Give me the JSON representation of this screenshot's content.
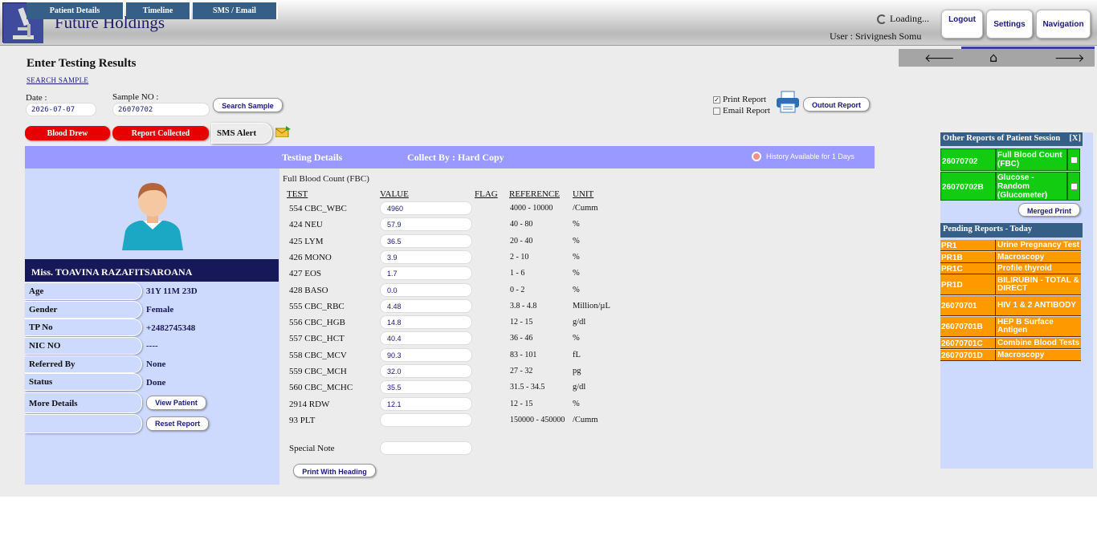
{
  "header": {
    "app_title": "Future Holdings",
    "loading_text": "Loading...",
    "user_line": "User : Srivignesh Somu",
    "buttons": {
      "logout": "Logout",
      "settings": "Settings",
      "navigation": "Navigation"
    }
  },
  "page": {
    "heading": "Enter Testing Results",
    "search_link": "SEARCH SAMPLE",
    "date_label": "Date :",
    "date_value": "2026-07-07",
    "sample_label": "Sample NO :",
    "sample_value": "26070702",
    "search_button": "Search Sample",
    "print_report_label": "Print Report",
    "email_report_label": "Email Report",
    "print_report_checked": true,
    "email_report_checked": false,
    "output_button": "Outout Report",
    "blood_drew": "Blood Drew",
    "report_collected": "Report Collected",
    "sms_alert": "SMS Alert"
  },
  "tabs": [
    "Patient Details",
    "Timeline",
    "SMS / Email"
  ],
  "testing": {
    "title": "Testing Details",
    "collect_by": "Collect By : Hard Copy",
    "history_note": "History Available for 1 Days",
    "panel_name": "Full Blood Count (FBC)",
    "columns": [
      "TEST",
      "VALUE",
      "FLAG",
      "REFERENCE",
      "UNIT"
    ],
    "rows": [
      {
        "test": "554 CBC_WBC",
        "value": "4960",
        "ref": "4000 - 10000",
        "unit": "/Cumm"
      },
      {
        "test": "424 NEU",
        "value": "57.9",
        "ref": "40 - 80",
        "unit": "%"
      },
      {
        "test": "425 LYM",
        "value": "36.5",
        "ref": "20 - 40",
        "unit": "%"
      },
      {
        "test": "426 MONO",
        "value": "3.9",
        "ref": "2 - 10",
        "unit": "%"
      },
      {
        "test": "427 EOS",
        "value": "1.7",
        "ref": "1 - 6",
        "unit": "%"
      },
      {
        "test": "428 BASO",
        "value": "0.0",
        "ref": "0 - 2",
        "unit": "%"
      },
      {
        "test": "555 CBC_RBC",
        "value": "4.48",
        "ref": "3.8 - 4.8",
        "unit": "Million/µL"
      },
      {
        "test": "556 CBC_HGB",
        "value": "14.8",
        "ref": "12 - 15",
        "unit": "g/dl"
      },
      {
        "test": "557 CBC_HCT",
        "value": "40.4",
        "ref": "36 - 46",
        "unit": "%"
      },
      {
        "test": "558 CBC_MCV",
        "value": "90.3",
        "ref": "83 - 101",
        "unit": "fL"
      },
      {
        "test": "559 CBC_MCH",
        "value": "32.0",
        "ref": "27 - 32",
        "unit": "pg"
      },
      {
        "test": "560 CBC_MCHC",
        "value": "35.5",
        "ref": "31.5 - 34.5",
        "unit": "g/dl"
      },
      {
        "test": "2914 RDW",
        "value": "12.1",
        "ref": "12 - 15",
        "unit": "%"
      },
      {
        "test": "93 PLT",
        "value": "",
        "ref": "150000 - 450000",
        "unit": "/Cumm"
      }
    ],
    "special_note_label": "Special Note",
    "special_note_value": "",
    "print_heading_button": "Print With Heading"
  },
  "patient": {
    "name": "Miss. TOAVINA RAZAFITSAROANA",
    "fields": [
      {
        "label": "Age",
        "value": "31Y 11M 23D"
      },
      {
        "label": "Gender",
        "value": "Female"
      },
      {
        "label": "TP No",
        "value": "+2482745348"
      },
      {
        "label": "NIC NO",
        "value": "----"
      },
      {
        "label": "Referred By",
        "value": "None"
      },
      {
        "label": "Status",
        "value": "Done"
      }
    ],
    "more_details_label": "More Details",
    "view_patient_button": "View Patient",
    "reset_report_button": "Reset Report"
  },
  "other_reports": {
    "title": "Other Reports of Patient Session",
    "close": "[X]",
    "items": [
      {
        "id": "26070702",
        "name": "Full Blood Count (FBC)"
      },
      {
        "id": "26070702B",
        "name": "Glucose - Random (Glucometer)"
      }
    ],
    "merged_print_button": "Merged Print"
  },
  "pending_reports": {
    "title": "Pending Reports - Today",
    "items": [
      {
        "id": "PR1",
        "name": "Urine Pregnancy Test"
      },
      {
        "id": "PR1B",
        "name": "Macroscopy"
      },
      {
        "id": "PR1C",
        "name": "Profile thyroid"
      },
      {
        "id": "PR1D",
        "name": "BILIRUBIN - TOTAL & DIRECT"
      },
      {
        "id": "26070701",
        "name": "HIV 1 & 2 ANTIBODY"
      },
      {
        "id": "26070701B",
        "name": "HEP B Surface Antigen"
      },
      {
        "id": "26070701C",
        "name": "Combine Blood Tests"
      },
      {
        "id": "26070701D",
        "name": "Macroscopy"
      }
    ]
  },
  "colors": {
    "tab_bar": "#9999ff",
    "tab": "#355f86",
    "patient_panel": "#cdd9fd",
    "name_bar": "#17185a",
    "red_button": "#e80000",
    "other_report_row": "#11cc11",
    "pending_row": "#ff9900"
  },
  "icons": {
    "logo": "microscope-icon",
    "loading": "spinner-icon",
    "back": "arrow-left-icon",
    "home": "home-icon",
    "forward": "arrow-right-icon",
    "printer": "printer-icon",
    "sms": "envelope-icon",
    "history": "clock-icon",
    "avatar": "user-avatar-icon"
  }
}
